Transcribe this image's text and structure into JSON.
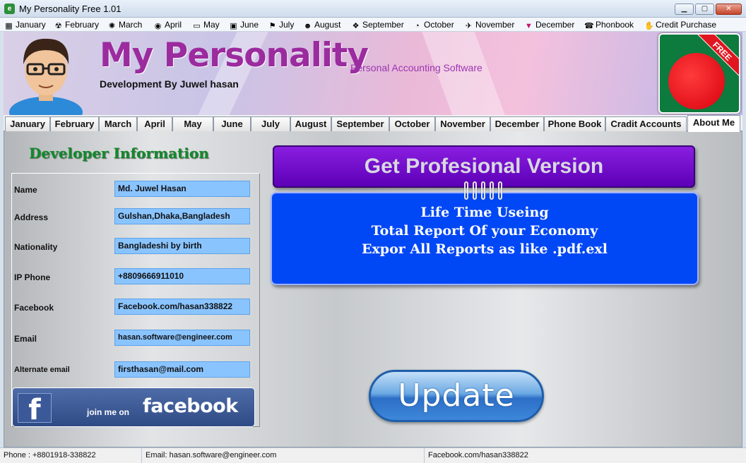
{
  "window": {
    "title": "My Personality Free 1.01"
  },
  "menubar": {
    "items": [
      {
        "label": "January",
        "icon": "calendar-icon",
        "glyph": "▦"
      },
      {
        "label": "February",
        "icon": "radiation-icon",
        "glyph": "☢"
      },
      {
        "label": "March",
        "icon": "film-reel-icon",
        "glyph": "✺"
      },
      {
        "label": "April",
        "icon": "globe-icon",
        "glyph": "◉"
      },
      {
        "label": "May",
        "icon": "laptop-icon",
        "glyph": "▭"
      },
      {
        "label": "June",
        "icon": "monitor-icon",
        "glyph": "▣"
      },
      {
        "label": "July",
        "icon": "flag-icon",
        "glyph": "⚑"
      },
      {
        "label": "August",
        "icon": "people-icon",
        "glyph": "☻"
      },
      {
        "label": "September",
        "icon": "network-icon",
        "glyph": "❖"
      },
      {
        "label": "October",
        "icon": "pie-chart-icon",
        "glyph": "◔"
      },
      {
        "label": "November",
        "icon": "satellite-icon",
        "glyph": "✈"
      },
      {
        "label": "December",
        "icon": "triangle-icon",
        "glyph": "▼"
      },
      {
        "label": "Phonbook",
        "icon": "phonebook-icon",
        "glyph": "☎"
      },
      {
        "label": "Credit Purchase",
        "icon": "handshake-icon",
        "glyph": "✋"
      }
    ]
  },
  "banner": {
    "title": "My Personality",
    "subtitle": "Personal Accounting Software",
    "developer_line": "Development By Juwel hasan",
    "badge": "FREE"
  },
  "tabs": [
    {
      "label": "January"
    },
    {
      "label": "February"
    },
    {
      "label": "March"
    },
    {
      "label": "April"
    },
    {
      "label": "May"
    },
    {
      "label": "June"
    },
    {
      "label": "July"
    },
    {
      "label": "August"
    },
    {
      "label": "September"
    },
    {
      "label": "October"
    },
    {
      "label": "November"
    },
    {
      "label": "December"
    },
    {
      "label": "Phone Book"
    },
    {
      "label": "Cradit Accounts"
    },
    {
      "label": "About Me",
      "active": true
    }
  ],
  "developer": {
    "heading": "Developer Information",
    "fields": [
      {
        "label": "Name",
        "value": "Md. Juwel Hasan"
      },
      {
        "label": "Address",
        "value": "Gulshan,Dhaka,Bangladesh"
      },
      {
        "label": "Nationality",
        "value": "Bangladeshi by birth"
      },
      {
        "label": "IP Phone",
        "value": "+8809666911010"
      },
      {
        "label": "Facebook",
        "value": "Facebook.com/hasan338822"
      },
      {
        "label": "Email",
        "value": "hasan.software@engineer.com"
      },
      {
        "label": "Alternate email",
        "value": "firsthasan@mail.com"
      }
    ],
    "facebook": {
      "logo_letter": "f",
      "join_text": "join me on",
      "word": "facebook"
    }
  },
  "promo": {
    "button_label": "Get Profesional Version",
    "features": [
      "Life Time Useing",
      "Total Report Of your Economy",
      "Expor All Reports as like .pdf.exl"
    ],
    "update_label": "Update"
  },
  "statusbar": {
    "phone": "Phone : +8801918-338822",
    "email": "Email: hasan.software@engineer.com",
    "facebook": "Facebook.com/hasan338822"
  },
  "colors": {
    "brand_title": "#9b2b9e",
    "dev_heading": "#108a2a",
    "pro_button": "#6a0ccf",
    "features_bg": "#0047f5",
    "field_bg": "#8ac4ff"
  }
}
